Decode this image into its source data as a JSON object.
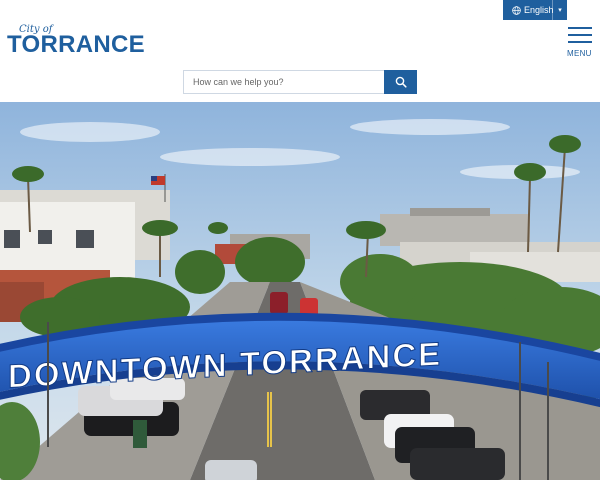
{
  "header": {
    "logo_city": "City of",
    "logo_name": "TORRANCE",
    "language_label": "English",
    "menu_label": "MENU",
    "search": {
      "placeholder": "How can we help you?"
    }
  },
  "hero": {
    "arch_text": "DOWNTOWN TORRANCE"
  },
  "colors": {
    "brand_blue": "#1f5f9e",
    "arch_blue": "#2f6fd0"
  },
  "icons": {
    "language": "globe-icon",
    "language_caret": "caret-down-icon",
    "menu": "hamburger-icon",
    "search": "search-icon"
  }
}
